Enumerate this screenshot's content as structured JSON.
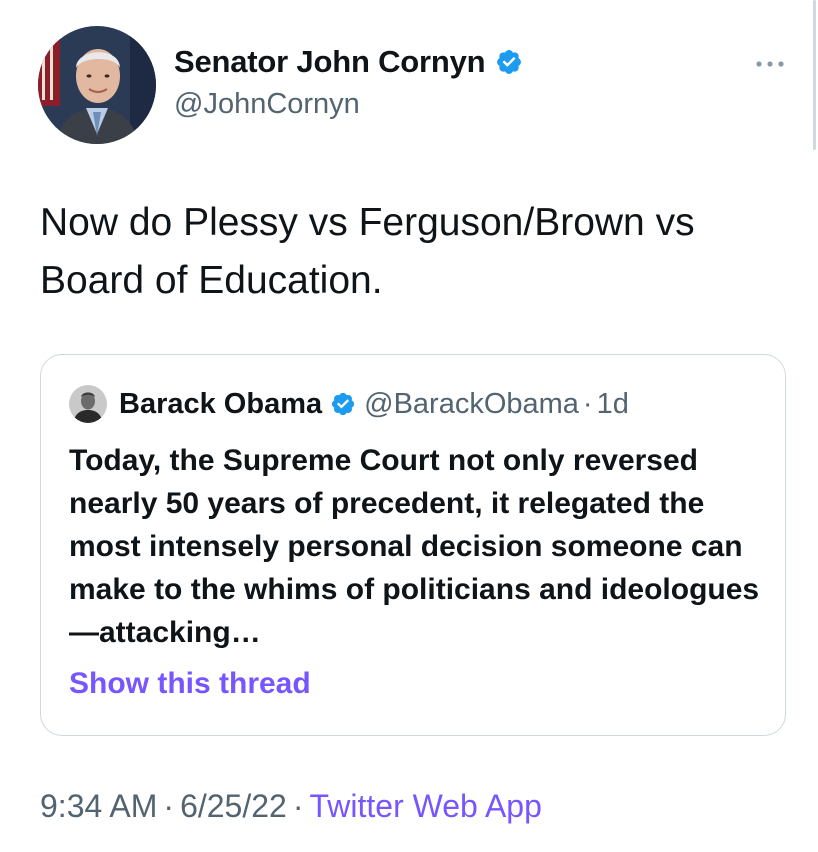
{
  "author": {
    "display_name": "Senator John Cornyn",
    "handle": "@JohnCornyn",
    "verified_icon": "verified-badge-icon",
    "avatar_icon": "profile-photo"
  },
  "tweet": {
    "text": "Now do Plessy vs Ferguson/Brown vs Board of Education."
  },
  "quoted_tweet": {
    "display_name": "Barack Obama",
    "handle": "@BarackObama",
    "separator": "·",
    "time": "1d",
    "text": "Today, the Supreme Court not only reversed nearly 50 years of precedent, it relegated the most intensely personal decision someone can make to the whims of politicians and ideologues—attacking…",
    "show_thread_label": "Show this thread"
  },
  "meta": {
    "time": "9:34 AM",
    "separator": "·",
    "date": "6/25/22",
    "source": "Twitter Web App"
  },
  "colors": {
    "verified": "#1d9bf0",
    "accent": "#7856ff",
    "secondary_text": "#536471",
    "border": "#cfd9de"
  }
}
